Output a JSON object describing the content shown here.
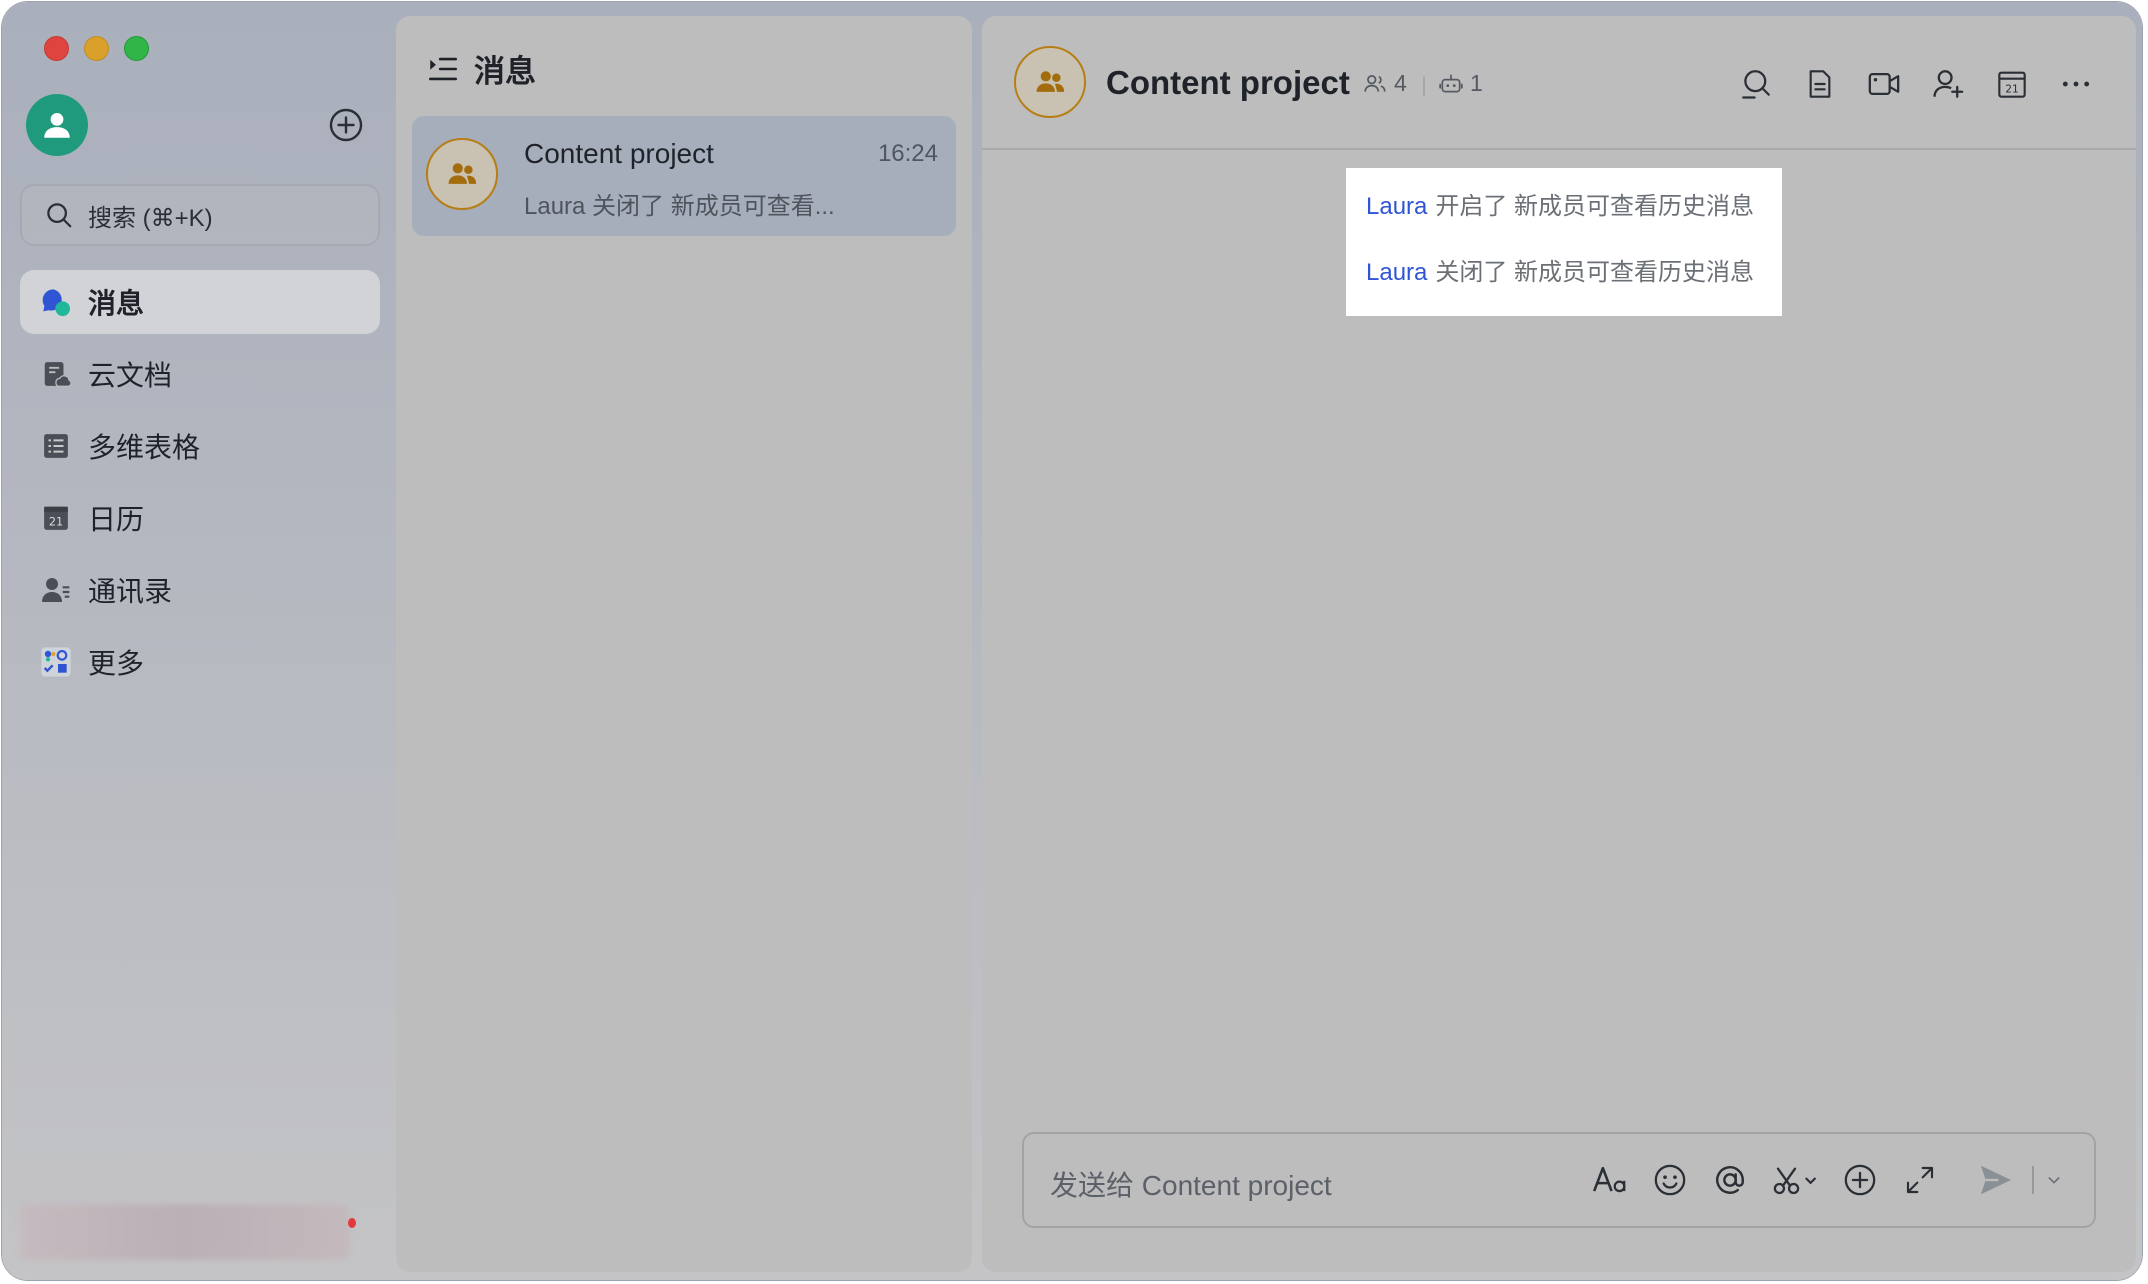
{
  "sidebar": {
    "search_placeholder": "搜索 (⌘+K)",
    "items": [
      {
        "label": "消息",
        "icon": "message-icon",
        "active": true
      },
      {
        "label": "云文档",
        "icon": "cloud-doc-icon"
      },
      {
        "label": "多维表格",
        "icon": "base-table-icon"
      },
      {
        "label": "日历",
        "icon": "calendar-icon"
      },
      {
        "label": "通讯录",
        "icon": "contacts-icon"
      },
      {
        "label": "更多",
        "icon": "apps-more-icon"
      }
    ]
  },
  "list": {
    "title": "消息",
    "conversations": [
      {
        "name": "Content project",
        "time": "16:24",
        "preview": "Laura 关闭了 新成员可查看..."
      }
    ]
  },
  "chat": {
    "title": "Content project",
    "member_count": "4",
    "bot_count": "1",
    "system_messages": [
      {
        "user": "Laura",
        "text": "开启了 新成员可查看历史消息"
      },
      {
        "user": "Laura",
        "text": "关闭了 新成员可查看历史消息"
      }
    ],
    "composer_placeholder": "发送给 Content project"
  },
  "colors": {
    "accent_link": "#2f55d4",
    "avatar_green": "#1f9a7c",
    "group_avatar_ring": "#b57e16"
  }
}
